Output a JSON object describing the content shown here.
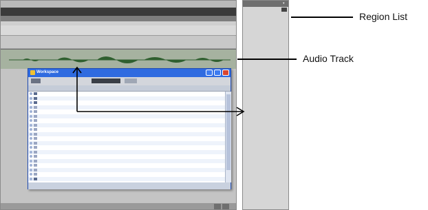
{
  "annotations": {
    "region_list": "Region List",
    "audio_track": "Audio Track"
  },
  "edit_window": {
    "ruler_numbers": [
      "",
      "",
      "",
      "",
      "",
      "",
      "",
      ""
    ],
    "track1_label": "",
    "track1_sub": "",
    "audio_track_name": ""
  },
  "region_list": {
    "title": "",
    "item": ""
  },
  "workspace": {
    "title": "Workspace",
    "toolbar_label": "",
    "toolbar_right": "",
    "columns": [
      "",
      "",
      "",
      "",
      "",
      "",
      "",
      ""
    ],
    "rows": [
      {
        "name": "",
        "type": "folder"
      },
      {
        "name": "",
        "type": "folder"
      },
      {
        "name": "",
        "type": "folder"
      },
      {
        "name": "",
        "type": "audio"
      },
      {
        "name": "",
        "type": "audio"
      },
      {
        "name": "",
        "type": "audio"
      },
      {
        "name": "",
        "type": "audio"
      },
      {
        "name": "",
        "type": "audio"
      },
      {
        "name": "",
        "type": "audio"
      },
      {
        "name": "",
        "type": "audio"
      },
      {
        "name": "",
        "type": "audio"
      },
      {
        "name": "",
        "type": "audio"
      },
      {
        "name": "",
        "type": "audio"
      },
      {
        "name": "",
        "type": "audio"
      },
      {
        "name": "",
        "type": "audio"
      },
      {
        "name": "",
        "type": "audio"
      },
      {
        "name": "",
        "type": "audio"
      },
      {
        "name": "",
        "type": "audio"
      },
      {
        "name": "",
        "type": "audio"
      },
      {
        "name": "",
        "type": "folder"
      }
    ]
  },
  "colors": {
    "dialog_titlebar": "#2f6be0",
    "dialog_close": "#d9462f",
    "audio_track_bg": "#a6b2a0",
    "waveform": "#2f5f2f",
    "arrow": "#000000"
  },
  "icons": {
    "close": "close-icon",
    "minimize": "minimize-icon",
    "maximize": "maximize-icon",
    "app": "workspace-icon"
  }
}
